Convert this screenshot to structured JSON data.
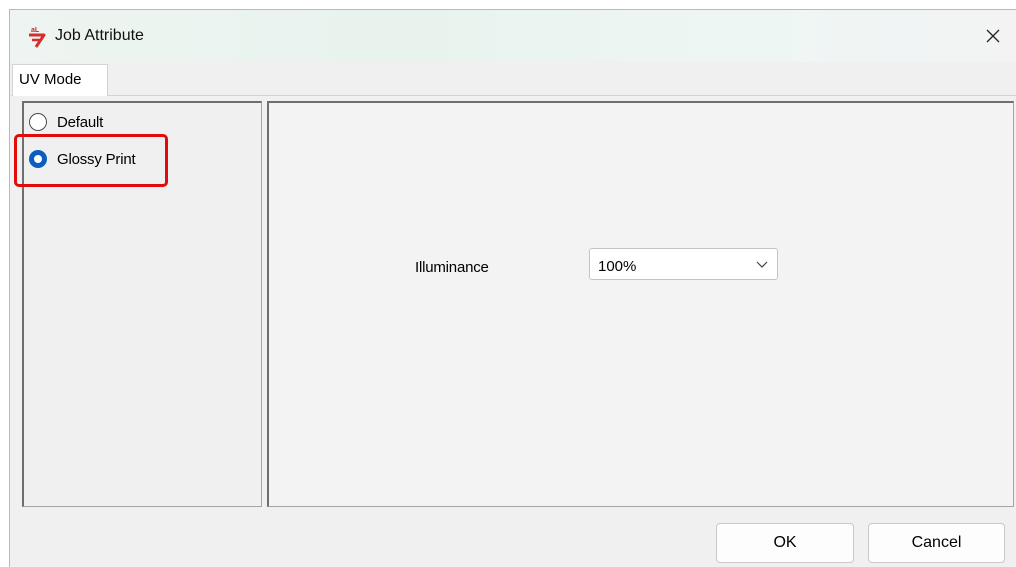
{
  "window": {
    "title": "Job Attribute",
    "app_icon": "app-logo-icon",
    "close_icon": "close-icon"
  },
  "tabs": [
    {
      "label": "UV Mode",
      "active": true
    }
  ],
  "mode_options": [
    {
      "label": "Default",
      "selected": false
    },
    {
      "label": "Glossy Print",
      "selected": true
    }
  ],
  "highlight_color": "#e10b0b",
  "accent_color": "#0a5ec2",
  "settings": {
    "illuminance_label": "Illuminance",
    "illuminance_value": "100%"
  },
  "buttons": {
    "ok_label": "OK",
    "cancel_label": "Cancel"
  }
}
